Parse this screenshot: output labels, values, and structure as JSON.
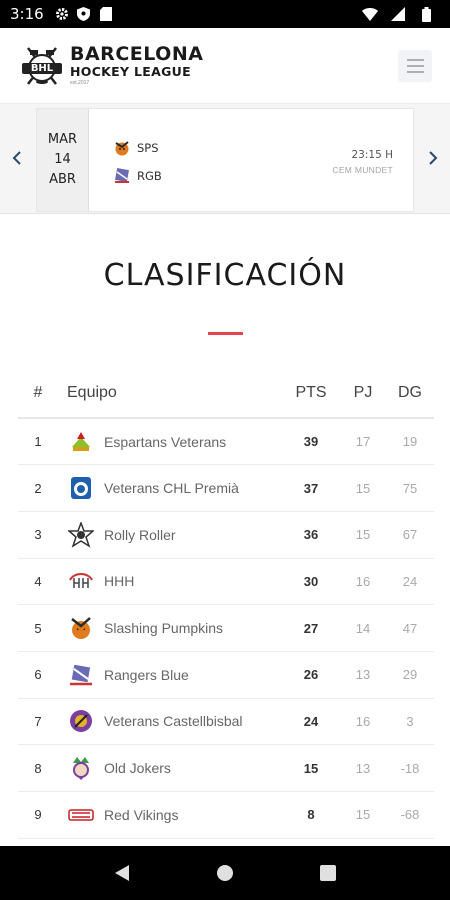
{
  "status_bar": {
    "time": "3:16"
  },
  "header": {
    "logo_badge_text": "BHL",
    "logo_line1": "BARCELONA",
    "logo_line2": "HOCKEY LEAGUE",
    "logo_line3": "est.2017"
  },
  "match": {
    "day_name": "MAR",
    "day_number": "14",
    "month": "ABR",
    "home_team": "SPS",
    "away_team": "RGB",
    "time": "23:15 H",
    "venue": "CEM MUNDET"
  },
  "standings": {
    "title": "CLASIFICACIÓN",
    "columns": {
      "pos": "#",
      "team": "Equipo",
      "pts": "PTS",
      "pj": "PJ",
      "dg": "DG"
    },
    "rows": [
      {
        "pos": "1",
        "team": "Espartans Veterans",
        "pts": "39",
        "pj": "17",
        "dg": "19",
        "logo": "espartans-logo-icon"
      },
      {
        "pos": "2",
        "team": "Veterans CHL Premià",
        "pts": "37",
        "pj": "15",
        "dg": "75",
        "logo": "chl-premia-logo-icon"
      },
      {
        "pos": "3",
        "team": "Rolly Roller",
        "pts": "36",
        "pj": "15",
        "dg": "67",
        "logo": "rolly-roller-logo-icon"
      },
      {
        "pos": "4",
        "team": "HHH",
        "pts": "30",
        "pj": "16",
        "dg": "24",
        "logo": "hhh-logo-icon"
      },
      {
        "pos": "5",
        "team": "Slashing Pumpkins",
        "pts": "27",
        "pj": "14",
        "dg": "47",
        "logo": "slashing-pumpkins-logo-icon"
      },
      {
        "pos": "6",
        "team": "Rangers Blue",
        "pts": "26",
        "pj": "13",
        "dg": "29",
        "logo": "rangers-blue-logo-icon"
      },
      {
        "pos": "7",
        "team": "Veterans Castellbisbal",
        "pts": "24",
        "pj": "16",
        "dg": "3",
        "logo": "castellbisbal-logo-icon"
      },
      {
        "pos": "8",
        "team": "Old Jokers",
        "pts": "15",
        "pj": "13",
        "dg": "-18",
        "logo": "old-jokers-logo-icon"
      },
      {
        "pos": "9",
        "team": "Red Vikings",
        "pts": "8",
        "pj": "15",
        "dg": "-68",
        "logo": "red-vikings-logo-icon"
      }
    ]
  },
  "colors": {
    "accent": "#e0464e",
    "menu_bg": "#f1f3f4",
    "muted": "#a9a9a9"
  }
}
